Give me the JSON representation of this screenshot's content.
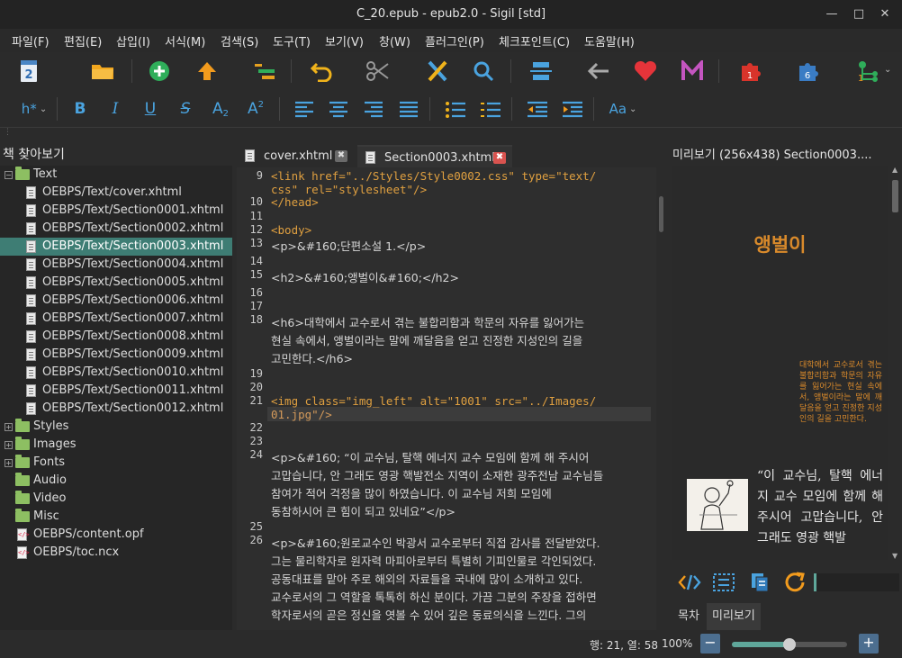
{
  "window": {
    "title": "C_20.epub - epub2.0 - Sigil [std]"
  },
  "menu": [
    "파일(F)",
    "편집(E)",
    "삽입(I)",
    "서식(M)",
    "검색(S)",
    "도구(T)",
    "보기(V)",
    "창(W)",
    "플러그인(P)",
    "체크포인트(C)",
    "도움말(H)"
  ],
  "toolbar": {
    "heading_label": "h*",
    "case_label": "Aa",
    "plugin_badges": [
      "1",
      "6",
      "1"
    ],
    "fmt": {
      "bold": "B",
      "italic": "I",
      "underline": "U",
      "strike": "S",
      "subscript": "A",
      "subscript_mark": "2",
      "superscript": "A",
      "superscript_mark": "2"
    }
  },
  "colors": {
    "accent": "#4aa3df",
    "selection": "#3e7d74",
    "close_tab": "#d9534f",
    "tag": "#e0a040",
    "heading": "#d98a2b"
  },
  "book_browser": {
    "title": "책 찾아보기",
    "items": [
      {
        "label": "Text",
        "type": "folder",
        "expanded": true
      },
      {
        "label": "OEBPS/Text/cover.xhtml",
        "type": "doc"
      },
      {
        "label": "OEBPS/Text/Section0001.xhtml",
        "type": "doc"
      },
      {
        "label": "OEBPS/Text/Section0002.xhtml",
        "type": "doc"
      },
      {
        "label": "OEBPS/Text/Section0003.xhtml",
        "type": "doc",
        "selected": true
      },
      {
        "label": "OEBPS/Text/Section0004.xhtml",
        "type": "doc"
      },
      {
        "label": "OEBPS/Text/Section0005.xhtml",
        "type": "doc"
      },
      {
        "label": "OEBPS/Text/Section0006.xhtml",
        "type": "doc"
      },
      {
        "label": "OEBPS/Text/Section0007.xhtml",
        "type": "doc"
      },
      {
        "label": "OEBPS/Text/Section0008.xhtml",
        "type": "doc"
      },
      {
        "label": "OEBPS/Text/Section0009.xhtml",
        "type": "doc"
      },
      {
        "label": "OEBPS/Text/Section0010.xhtml",
        "type": "doc"
      },
      {
        "label": "OEBPS/Text/Section0011.xhtml",
        "type": "doc"
      },
      {
        "label": "OEBPS/Text/Section0012.xhtml",
        "type": "doc"
      },
      {
        "label": "Styles",
        "type": "folder",
        "expanded": false
      },
      {
        "label": "Images",
        "type": "folder",
        "expanded": false
      },
      {
        "label": "Fonts",
        "type": "folder",
        "expanded": false
      },
      {
        "label": "Audio",
        "type": "folder"
      },
      {
        "label": "Video",
        "type": "folder"
      },
      {
        "label": "Misc",
        "type": "folder"
      },
      {
        "label": "OEBPS/content.opf",
        "type": "code"
      },
      {
        "label": "OEBPS/toc.ncx",
        "type": "code"
      }
    ]
  },
  "tabs": [
    {
      "label": "cover.xhtml",
      "active": false
    },
    {
      "label": "Section0003.xhtml",
      "active": true
    }
  ],
  "code": {
    "line_numbers": [
      "9",
      "10",
      "11",
      "12",
      "13",
      "14",
      "15",
      "16",
      "17",
      "18",
      "19",
      "20",
      "21",
      "22",
      "23",
      "24",
      "25",
      "26"
    ],
    "lines": [
      "  <link href=\"../Styles/Style0002.css\" type=\"text/",
      "css\" rel=\"stylesheet\"/>",
      "</head>",
      "<body>",
      "  <p>&#160;단편소설 1.</p>",
      "  <h2>&#160;앵벌이&#160;</h2>",
      "  <h6>대학에서 교수로서 겪는 불합리함과 학문의 자유를 잃어가는",
      "현실 속에서, 앵벌이라는 말에 깨달음을 얻고 진정한 지성인의 길을",
      "고민한다.</h6>",
      "<img class=\"img_left\" alt=\"1001\" src=\"../Images/",
      "01.jpg\"/>",
      "  <p>&#160; “이 교수님, 탈핵 에너지 교수 모임에 함께 해 주시어",
      "고맙습니다, 안 그래도 영광 핵발전소 지역이 소재한 광주전남 교수님들",
      "참여가 적어 걱정을 많이 하였습니다. 이 교수님 저희 모임에",
      "동참하시어 큰 힘이 되고 있네요”</p>",
      "  <p>&#160;원로교수인 박광서 교수로부터 직접 감사를 전달받았다.",
      "그는 물리학자로 원자력 마피아로부터 특별히 기피인물로 각인되었다.",
      "공동대표를 맡아 주로 해외의 자료들을 국내에 많이 소개하고 있다.",
      "교수로서의 그 역할을 톡톡히 하신 분이다. 가끔 그분의 주장을 접하면",
      "학자로서의 곧은 정신을 엿볼 수 있어 깊은 동료의식을 느낀다. 그의"
    ]
  },
  "preview": {
    "title": "미리보기 (256x438) Section0003....",
    "heading": "앵벌이",
    "subtitle": "대학에서 교수로서 겪는 불합리함과 학문의 자유를 잃어가는 현실 속에서, 앵벌이라는 말에 깨달음을 얻고 진정한 지성인의 길을 고민한다.",
    "paragraph": "“이 교수님, 탈핵 에너지 교수 모임에 함께 해 주시어 고맙습니다, 안 그래도 영광 핵발",
    "bottom_tabs": [
      "목차",
      "미리보기"
    ]
  },
  "status": {
    "position": "행: 21, 열: 58",
    "zoom": "100%",
    "zoom_level": 0.5
  }
}
